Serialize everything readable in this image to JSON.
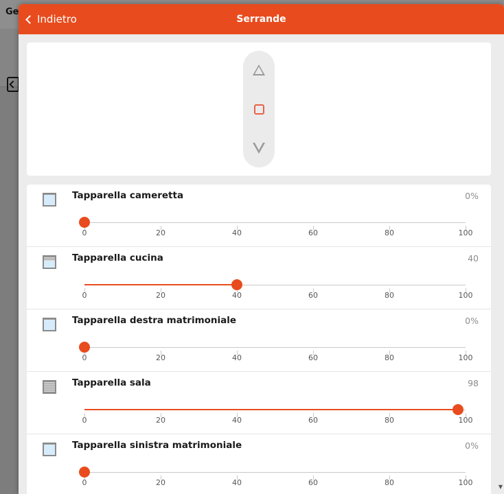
{
  "background_app": {
    "title_fragment": "Ge"
  },
  "dialog": {
    "back_label": "Indietro",
    "title": "Serrande",
    "controls": {
      "up_icon": "triangle-up-icon",
      "stop_icon": "square-stop-icon",
      "down_icon": "triangle-down-icon"
    },
    "slider_ticks": [
      "0",
      "20",
      "40",
      "60",
      "80",
      "100"
    ],
    "shutters": [
      {
        "name": "Tapparella cameretta",
        "value_label": "0%",
        "level": 0
      },
      {
        "name": "Tapparella cucina",
        "value_label": "40",
        "level": 40
      },
      {
        "name": "Tapparella destra matrimoniale",
        "value_label": "0%",
        "level": 0
      },
      {
        "name": "Tapparella sala",
        "value_label": "98",
        "level": 98
      },
      {
        "name": "Tapparella sinistra matrimoniale",
        "value_label": "0%",
        "level": 0
      }
    ],
    "accent_color": "#e84c1e"
  }
}
